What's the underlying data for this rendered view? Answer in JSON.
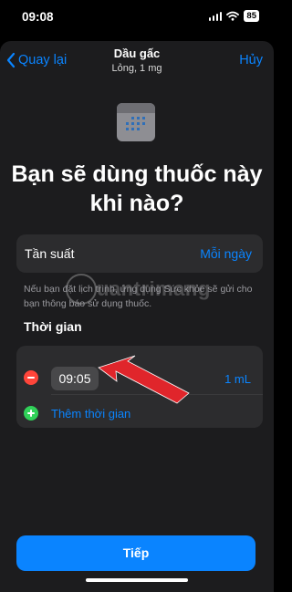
{
  "status_bar": {
    "time": "09:08",
    "battery": "85"
  },
  "nav": {
    "back_label": "Quay lại",
    "title": "Dầu gấc",
    "subtitle": "Lỏng, 1 mg",
    "cancel_label": "Hủy"
  },
  "heading": "Bạn sẽ dùng thuốc này khi nào?",
  "frequency": {
    "label": "Tần suất",
    "value": "Mỗi ngày"
  },
  "note": "Nếu bạn đặt lịch trình, ứng dụng Sức khỏe sẽ gửi cho bạn thông báo sử dụng thuốc.",
  "section_title": "Thời gian",
  "schedule": [
    {
      "time": "09:05",
      "dose": "1 mL"
    }
  ],
  "add_time_label": "Thêm thời gian",
  "next_button": "Tiếp",
  "watermark": "uantrimang",
  "colors": {
    "accent": "#0a84ff",
    "remove": "#ff453a",
    "add": "#30d158",
    "annotation_arrow": "#e0252b"
  }
}
